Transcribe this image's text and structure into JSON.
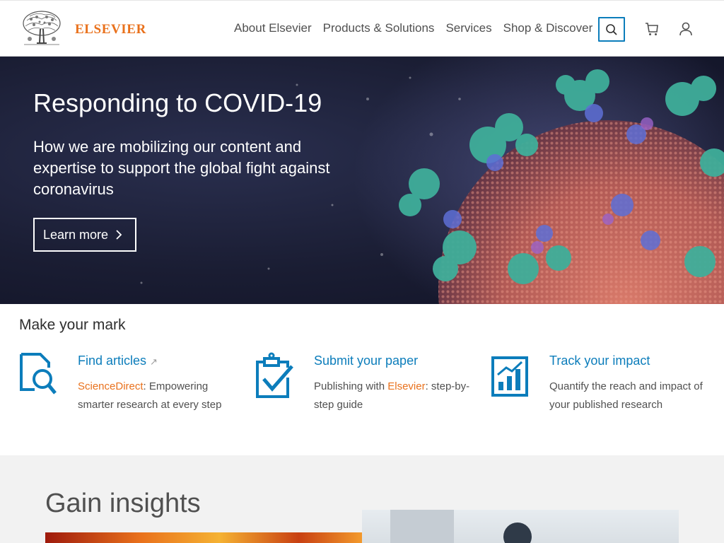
{
  "header": {
    "logo_text": "ELSEVIER",
    "nav": [
      {
        "label": "About Elsevier"
      },
      {
        "label": "Products & Solutions"
      },
      {
        "label": "Services"
      },
      {
        "label": "Shop & Discover"
      }
    ],
    "icons": {
      "search": "search-icon",
      "cart": "cart-icon",
      "user": "user-icon"
    }
  },
  "hero": {
    "title": "Responding to COVID-19",
    "subtitle": "How we are mobilizing our content and expertise to support the global fight against coronavirus",
    "cta_label": "Learn more"
  },
  "mark": {
    "title": "Make your mark",
    "items": [
      {
        "title": "Find articles",
        "desc_link": "ScienceDirect",
        "desc_rest": ": Empowering smarter research at every step",
        "icon": "document-search-icon"
      },
      {
        "title": "Submit your paper",
        "desc_pre": "Publishing with ",
        "desc_link": "Elsevier",
        "desc_rest": ": step-by-step guide",
        "icon": "clipboard-check-icon"
      },
      {
        "title": "Track your impact",
        "desc": "Quantify the reach and impact of your published research",
        "icon": "bar-chart-icon"
      }
    ]
  },
  "insights": {
    "title": "Gain insights"
  },
  "colors": {
    "brand_orange": "#e9711c",
    "link_blue": "#0c7dbb"
  }
}
